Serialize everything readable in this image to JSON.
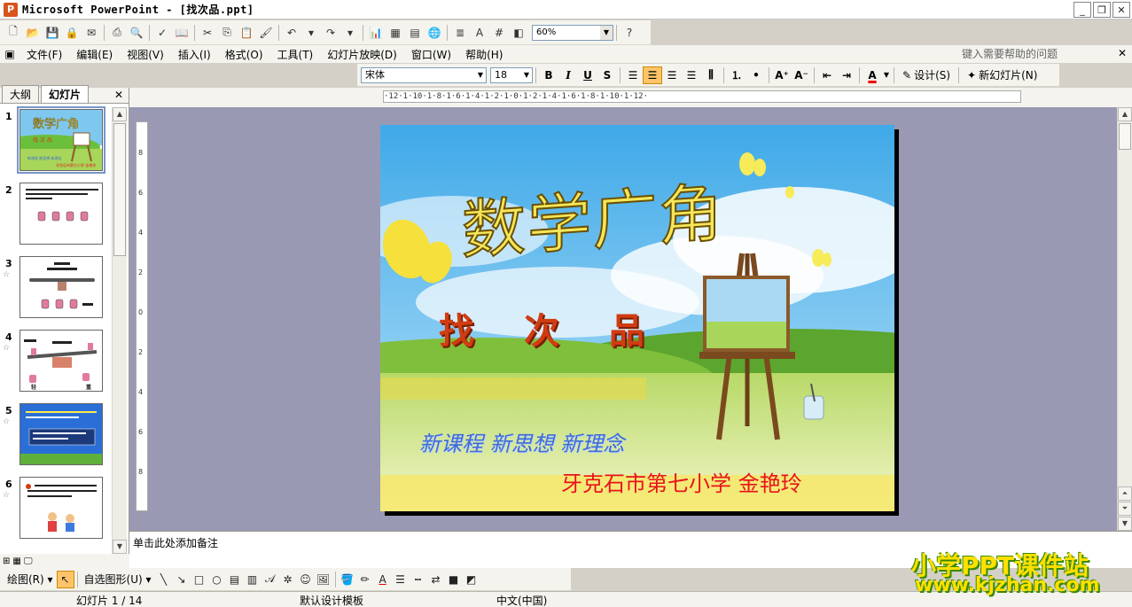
{
  "window": {
    "title": "Microsoft PowerPoint - [找次品.ppt]",
    "app_icon_letter": "P",
    "minimize": "_",
    "restore": "❐",
    "close": "✕"
  },
  "toolbar": {
    "zoom": "60%"
  },
  "menu": {
    "items": [
      "文件(F)",
      "编辑(E)",
      "视图(V)",
      "插入(I)",
      "格式(O)",
      "工具(T)",
      "幻灯片放映(D)",
      "窗口(W)",
      "帮助(H)"
    ],
    "help_placeholder": "键入需要帮助的问题",
    "close": "✕"
  },
  "format_toolbar": {
    "font": "宋体",
    "size": "18",
    "bold": "B",
    "italic": "I",
    "underline": "U",
    "shadow": "S",
    "design": "设计(S)",
    "new_slide": "新幻灯片(N)"
  },
  "left_panel": {
    "tabs": [
      "大纲",
      "幻灯片"
    ],
    "close": "✕",
    "slides": [
      {
        "num": "1",
        "star": ""
      },
      {
        "num": "2",
        "star": ""
      },
      {
        "num": "3",
        "star": "☆"
      },
      {
        "num": "4",
        "star": "☆"
      },
      {
        "num": "5",
        "star": "☆"
      },
      {
        "num": "6",
        "star": "☆"
      }
    ]
  },
  "ruler": {
    "horizontal": "·12·1·10·1·8·1·6·1·4·1·2·1·0·1·2·1·4·1·6·1·8·1·10·1·12·",
    "vertical": [
      "8",
      "6",
      "4",
      "2",
      "0",
      "2",
      "4",
      "6",
      "8"
    ]
  },
  "slide": {
    "title": "数学广角",
    "subtitle": "找次品",
    "motto": "新课程 新思想 新理念",
    "author": "牙克石市第七小学 金艳玲"
  },
  "notes": {
    "placeholder": "单击此处添加备注"
  },
  "draw_toolbar": {
    "draw": "绘图(R)",
    "autoshapes": "自选图形(U)"
  },
  "status": {
    "slide": "幻灯片 1 / 14",
    "template": "默认设计模板",
    "language": "中文(中国)"
  },
  "watermark": {
    "line1": "小学PPT课件站",
    "line2": "www.kjzhan.com"
  },
  "colors": {
    "accent": "#316ac5",
    "slide_title": "#f5e65a",
    "subtitle": "#d13c12",
    "author": "#e8121c"
  }
}
